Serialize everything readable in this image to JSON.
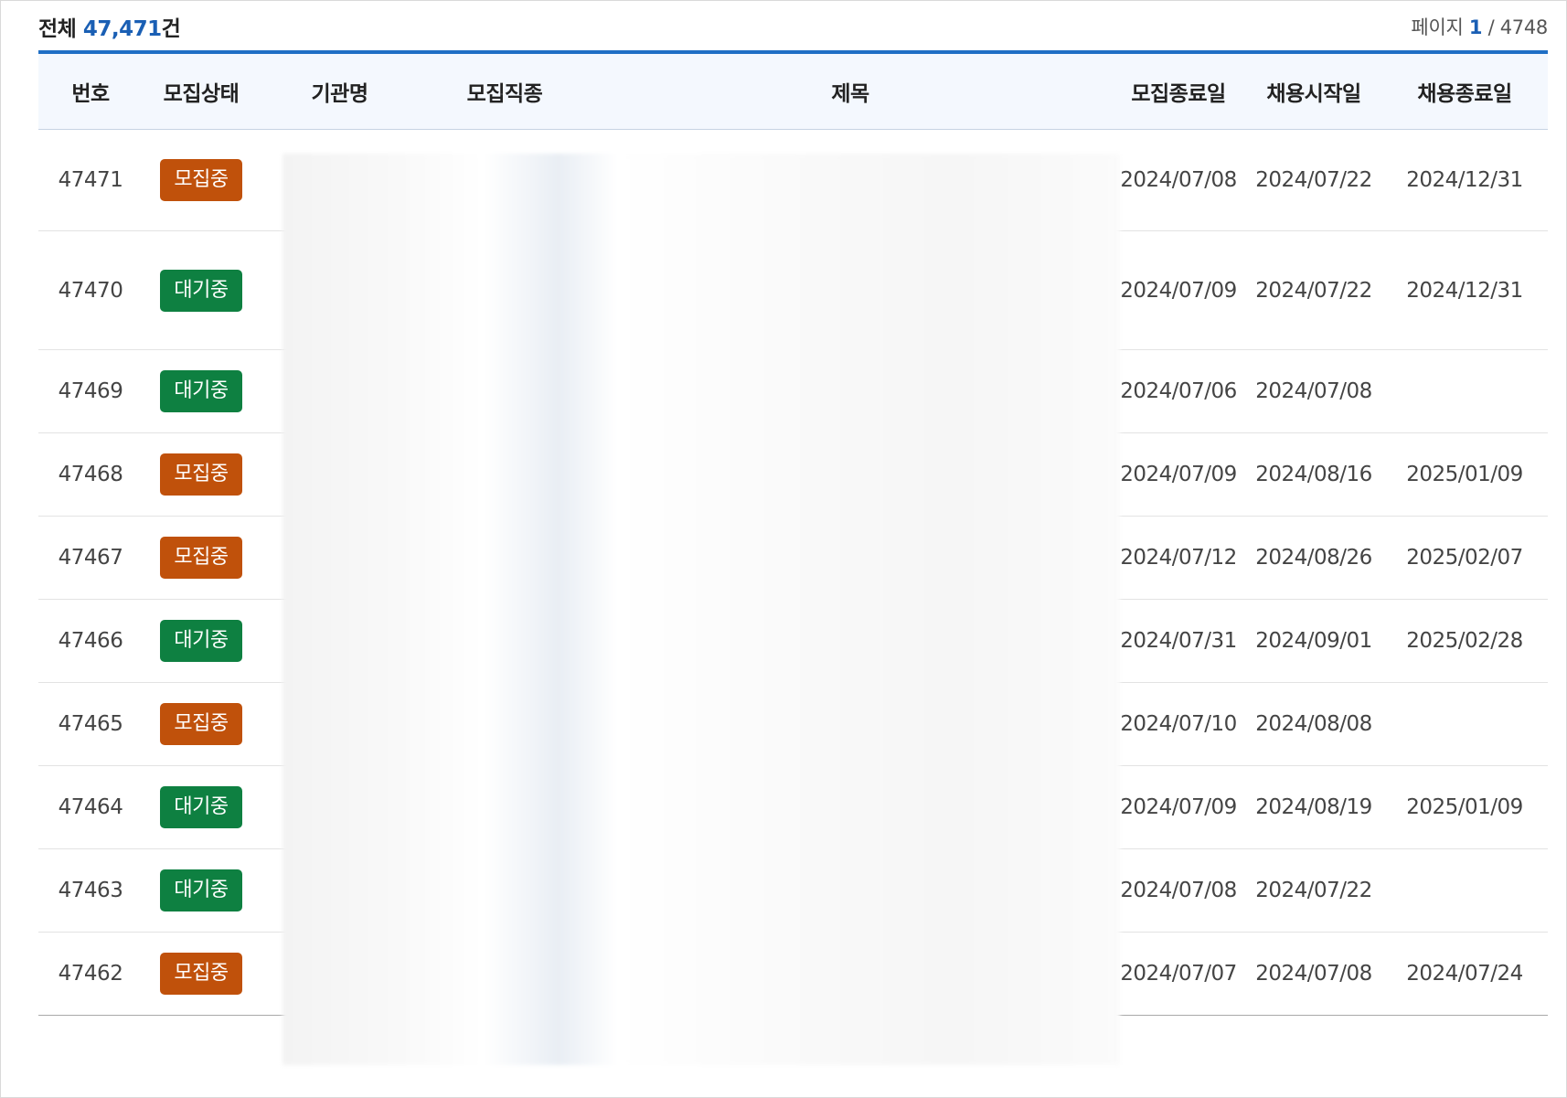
{
  "header": {
    "total_prefix": "전체",
    "total_count": "47,471",
    "total_suffix": "건",
    "page_label": "페이지",
    "current_page": "1",
    "page_separator": "/",
    "total_pages": "4748"
  },
  "columns": [
    "번호",
    "모집상태",
    "기관명",
    "모집직종",
    "제목",
    "모집종료일",
    "채용시작일",
    "채용종료일"
  ],
  "status_colors": {
    "모집중": "#c0510b",
    "대기중": "#0e8041"
  },
  "rows": [
    {
      "no": "47471",
      "status": "모집중",
      "end": "2024/07/08",
      "hire_start": "2024/07/22",
      "hire_end": "2024/12/31"
    },
    {
      "no": "47470",
      "status": "대기중",
      "end": "2024/07/09",
      "hire_start": "2024/07/22",
      "hire_end": "2024/12/31"
    },
    {
      "no": "47469",
      "status": "대기중",
      "end": "2024/07/06",
      "hire_start": "2024/07/08",
      "hire_end": ""
    },
    {
      "no": "47468",
      "status": "모집중",
      "end": "2024/07/09",
      "hire_start": "2024/08/16",
      "hire_end": "2025/01/09"
    },
    {
      "no": "47467",
      "status": "모집중",
      "end": "2024/07/12",
      "hire_start": "2024/08/26",
      "hire_end": "2025/02/07"
    },
    {
      "no": "47466",
      "status": "대기중",
      "end": "2024/07/31",
      "hire_start": "2024/09/01",
      "hire_end": "2025/02/28"
    },
    {
      "no": "47465",
      "status": "모집중",
      "end": "2024/07/10",
      "hire_start": "2024/08/08",
      "hire_end": ""
    },
    {
      "no": "47464",
      "status": "대기중",
      "end": "2024/07/09",
      "hire_start": "2024/08/19",
      "hire_end": "2025/01/09"
    },
    {
      "no": "47463",
      "status": "대기중",
      "end": "2024/07/08",
      "hire_start": "2024/07/22",
      "hire_end": ""
    },
    {
      "no": "47462",
      "status": "모집중",
      "end": "2024/07/07",
      "hire_start": "2024/07/08",
      "hire_end": "2024/07/24"
    }
  ]
}
